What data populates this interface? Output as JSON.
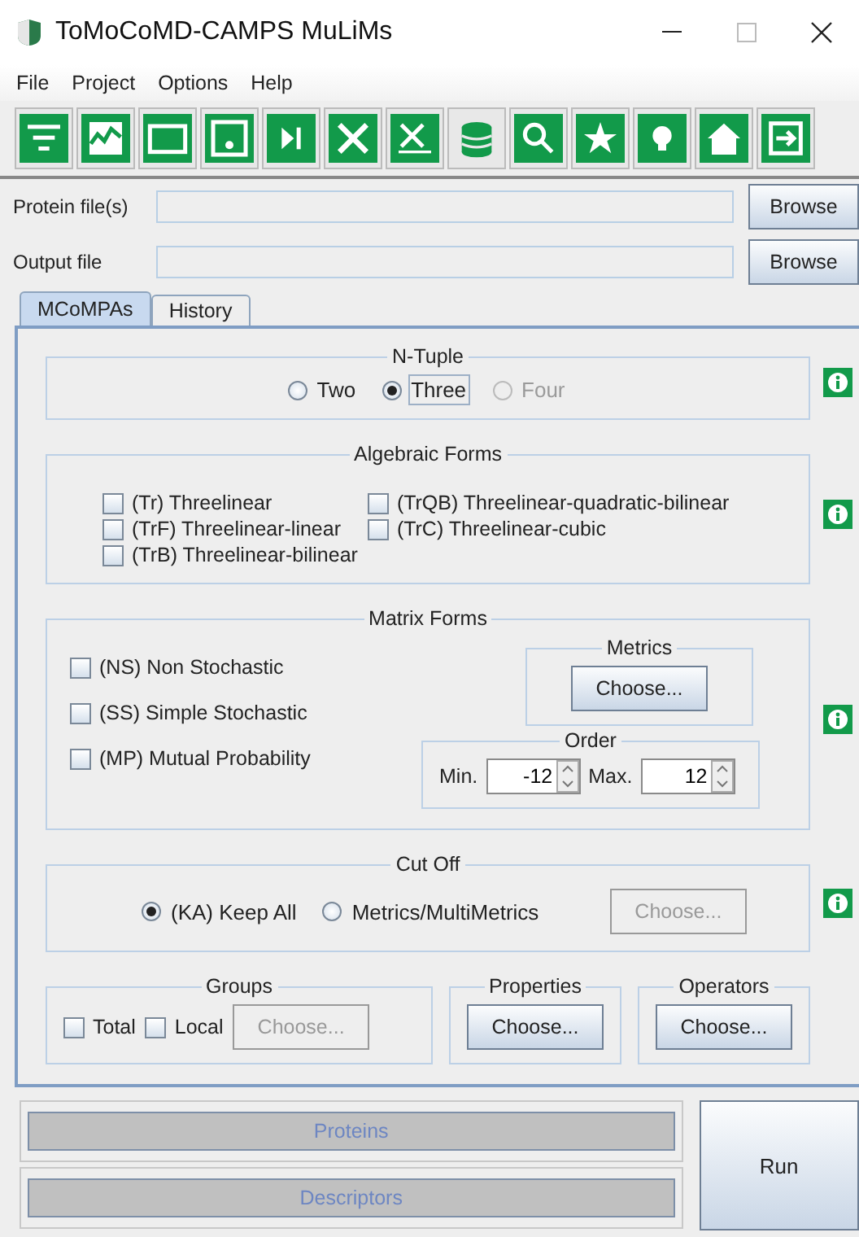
{
  "window": {
    "title": "ToMoCoMD-CAMPS MuLiMs"
  },
  "menu": [
    "File",
    "Project",
    "Options",
    "Help"
  ],
  "files": [
    {
      "label": "Protein file(s)",
      "button": "Browse"
    },
    {
      "label": "Output file",
      "button": "Browse"
    }
  ],
  "tabs": [
    {
      "label": "MCoMPAs",
      "selected": true
    },
    {
      "label": "History",
      "selected": false
    }
  ],
  "ntuple": {
    "title": "N-Tuple",
    "options": [
      {
        "label": "Two",
        "selected": false,
        "disabled": false,
        "focused": false
      },
      {
        "label": "Three",
        "selected": true,
        "disabled": false,
        "focused": true
      },
      {
        "label": "Four",
        "selected": false,
        "disabled": true,
        "focused": false
      }
    ]
  },
  "algebraic": {
    "title": "Algebraic Forms",
    "items": [
      {
        "label": "(Tr) Threelinear",
        "checked": false
      },
      {
        "label": "(TrQB) Threelinear-quadratic-bilinear",
        "checked": false
      },
      {
        "label": "(TrF) Threelinear-linear",
        "checked": false
      },
      {
        "label": "(TrC) Threelinear-cubic",
        "checked": false
      },
      {
        "label": "(TrB) Threelinear-bilinear",
        "checked": false
      }
    ]
  },
  "matrix": {
    "title": "Matrix Forms",
    "items": [
      {
        "label": "(NS) Non Stochastic",
        "checked": false
      },
      {
        "label": "(SS) Simple Stochastic",
        "checked": false
      },
      {
        "label": "(MP) Mutual Probability",
        "checked": false
      }
    ],
    "metrics": {
      "title": "Metrics",
      "button": {
        "label": "Choose...",
        "disabled": false
      }
    },
    "order": {
      "title": "Order",
      "min_label": "Min.",
      "min": "-12",
      "max_label": "Max.",
      "max": "12"
    }
  },
  "cutoff": {
    "title": "Cut Off",
    "options": [
      {
        "label": "(KA) Keep All",
        "selected": true,
        "disabled": false,
        "focused": false
      },
      {
        "label": "Metrics/MultiMetrics",
        "selected": false,
        "disabled": false,
        "focused": false
      }
    ],
    "button": {
      "label": "Choose...",
      "disabled": true
    }
  },
  "groups": {
    "title": "Groups",
    "items": [
      {
        "label": "Total",
        "checked": false
      },
      {
        "label": "Local",
        "checked": false
      }
    ],
    "button": {
      "label": "Choose...",
      "disabled": true
    }
  },
  "properties": {
    "title": "Properties",
    "button": {
      "label": "Choose...",
      "disabled": false
    }
  },
  "operators": {
    "title": "Operators",
    "button": {
      "label": "Choose...",
      "disabled": false
    }
  },
  "progress": [
    {
      "label": "Proteins"
    },
    {
      "label": "Descriptors"
    }
  ],
  "run_button": "Run"
}
